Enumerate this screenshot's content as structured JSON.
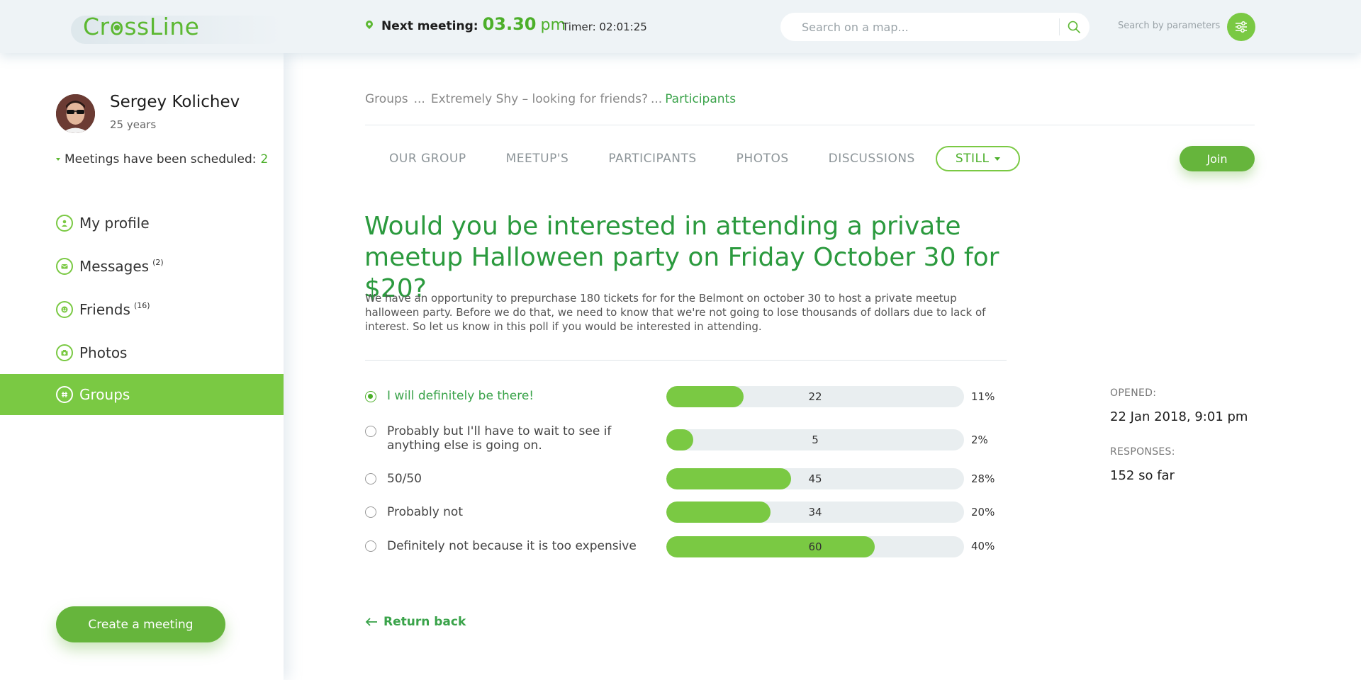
{
  "header": {
    "logo_pre": "Cr",
    "logo_o": "o",
    "logo_post": "ssLine",
    "next_meeting_label": "Next meeting:",
    "next_meeting_time": "03.30",
    "next_meeting_ampm": "pm",
    "timer": "Timer: 02:01:25",
    "search_placeholder": "Search on a map...",
    "search_by_parameters": "Search by parameters"
  },
  "sidebar": {
    "user_name": "Sergey Kolichev",
    "user_age": "25 years",
    "meetings_label": "Meetings have been scheduled:",
    "meetings_count": "2",
    "items": [
      {
        "label": "My profile",
        "badge": ""
      },
      {
        "label": "Messages",
        "badge": "(2)"
      },
      {
        "label": "Friends",
        "badge": "(16)"
      },
      {
        "label": "Photos",
        "badge": ""
      },
      {
        "label": "Groups",
        "badge": ""
      }
    ],
    "active_item": "Groups",
    "create_button": "Create a meeting"
  },
  "breadcrumb": {
    "items": [
      "Groups",
      "...",
      "Extremely Shy – looking for friends?",
      "..."
    ],
    "current": "Participants"
  },
  "tabs": {
    "items": [
      "OUR GROUP",
      "MEETUP'S",
      "PARTICIPANTS",
      "PHOTOS",
      "DISCUSSIONS"
    ],
    "more_label": "STILL",
    "join_button": "Join"
  },
  "poll": {
    "title": "Would you be interested in attending a private meetup Halloween party on Friday October 30 for $20?",
    "description": "We have an opportunity to prepurchase 180 tickets for for the Belmont on october 30 to host a private meetup halloween party. Before we do that, we need to know that we're not going to lose thousands of dollars due to lack of interest. So let us know in this poll if you would be interested in attending.",
    "options": [
      {
        "label": "I will definitely be there!",
        "count": "22",
        "percent": "11%",
        "fill": 0.26,
        "selected": true
      },
      {
        "label": "Probably but I'll have to wait to see if anything else is going on.",
        "count": "5",
        "percent": "2%",
        "fill": 0.09,
        "selected": false
      },
      {
        "label": "50/50",
        "count": "45",
        "percent": "28%",
        "fill": 0.42,
        "selected": false
      },
      {
        "label": "Probably not",
        "count": "34",
        "percent": "20%",
        "fill": 0.35,
        "selected": false
      },
      {
        "label": "Definitely not because it is too expensive",
        "count": "60",
        "percent": "40%",
        "fill": 0.7,
        "selected": false
      }
    ],
    "return_label": "Return back"
  },
  "meta": {
    "opened_label": "OPENED:",
    "opened_value": "22 Jan 2018,  9:01 pm",
    "responses_label": "RESPONSES:",
    "responses_value": "152 so far"
  },
  "colors": {
    "brand_green": "#7ac943",
    "accent_green": "#4caf2a",
    "title_green": "#2b9a3e",
    "header_bg": "#eef3f6"
  }
}
